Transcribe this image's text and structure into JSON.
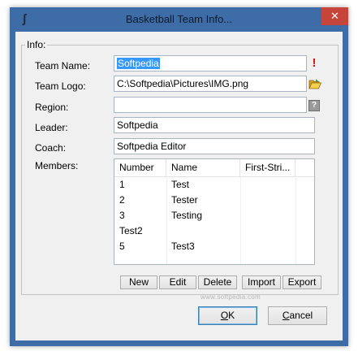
{
  "window": {
    "title": "Basketball Team Info...",
    "close_glyph": "✕"
  },
  "info": {
    "group_label": "Info:",
    "team_name_label": "Team Name:",
    "team_name_value": "Softpedia",
    "team_logo_label": "Team Logo:",
    "team_logo_value": "C:\\Softpedia\\Pictures\\IMG.png",
    "region_label": "Region:",
    "region_value": "",
    "leader_label": "Leader:",
    "leader_value": "Softpedia",
    "coach_label": "Coach:",
    "coach_value": "Softpedia Editor",
    "members_label": "Members:"
  },
  "members": {
    "columns": [
      "Number",
      "Name",
      "First-Stri..."
    ],
    "rows": [
      {
        "number": "1",
        "name": "Test"
      },
      {
        "number": "2",
        "name": "Tester"
      },
      {
        "number": "3",
        "name": "Testing"
      },
      {
        "number": "Test2",
        "name": ""
      },
      {
        "number": "5",
        "name": "Test3"
      }
    ]
  },
  "toolbar": {
    "new_label": "New",
    "edit_label": "Edit",
    "delete_label": "Delete",
    "import_label": "Import",
    "export_label": "Export"
  },
  "watermark": "www.softpedia.com",
  "dialog": {
    "ok_label": "OK",
    "ok_rest": "K",
    "ok_mnemonic": "O",
    "cancel_label": "Cancel",
    "cancel_mnemonic": "C",
    "cancel_rest": "ancel"
  },
  "icons": {
    "app": "app-icon",
    "warning": "exclamation-icon",
    "browse": "folder-open-icon",
    "help": "question-mark-icon"
  },
  "colors": {
    "titlebar": "#3d6ca6",
    "close": "#c7443a",
    "selection": "#3399ff"
  }
}
